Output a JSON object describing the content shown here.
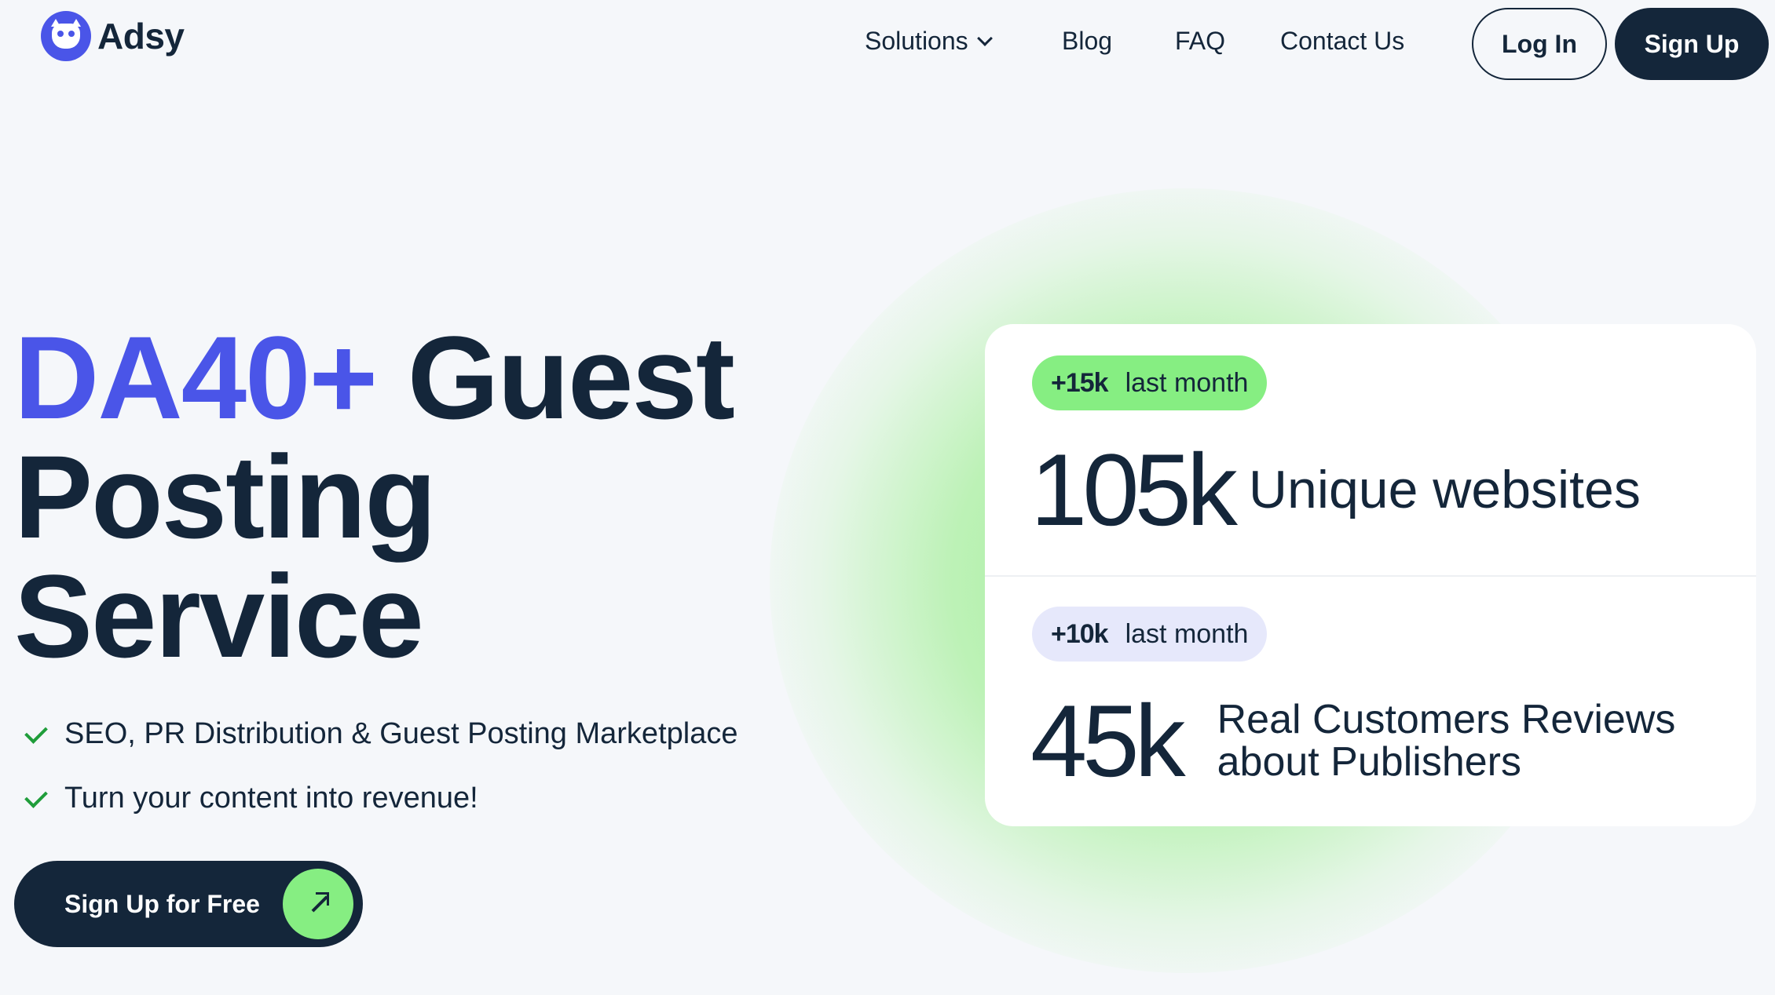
{
  "brand": {
    "name": "Adsy",
    "logo_icon": "owl-icon",
    "accent": "#4a55e8"
  },
  "nav": {
    "items": [
      {
        "label": "Solutions",
        "has_dropdown": true
      },
      {
        "label": "Blog"
      },
      {
        "label": "FAQ"
      },
      {
        "label": "Contact Us"
      }
    ],
    "login_label": "Log In",
    "signup_label": "Sign Up"
  },
  "hero": {
    "title_accent": "DA40+",
    "title_line1_rest": "Guest",
    "title_line2": "Posting",
    "title_line3": "Service",
    "features": [
      "SEO, PR Distribution & Guest Posting Marketplace",
      "Turn your content into revenue!"
    ],
    "cta_label": "Sign Up for Free"
  },
  "stats": [
    {
      "badge_num": "+15k",
      "badge_text": "last month",
      "value": "105k",
      "label": "Unique websites"
    },
    {
      "badge_num": "+10k",
      "badge_text": "last month",
      "value": "45k",
      "label": "Real Customers Reviews about Publishers"
    }
  ],
  "colors": {
    "dark": "#14263a",
    "green": "#86ee82",
    "lavender": "#e6e8fb",
    "check": "#1f9d3a"
  }
}
